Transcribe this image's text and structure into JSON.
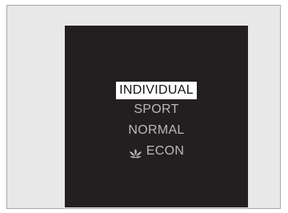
{
  "drive_mode_menu": {
    "items": [
      {
        "label": "INDIVIDUAL",
        "selected": true
      },
      {
        "label": "SPORT",
        "selected": false
      },
      {
        "label": "NORMAL",
        "selected": false
      },
      {
        "label": "ECON",
        "selected": false,
        "icon": "econ-leaf-icon"
      }
    ]
  },
  "colors": {
    "screen_background": "#231f20",
    "selected_background": "#ffffff",
    "selected_text": "#111111",
    "unselected_text": "#b9b9b9"
  }
}
